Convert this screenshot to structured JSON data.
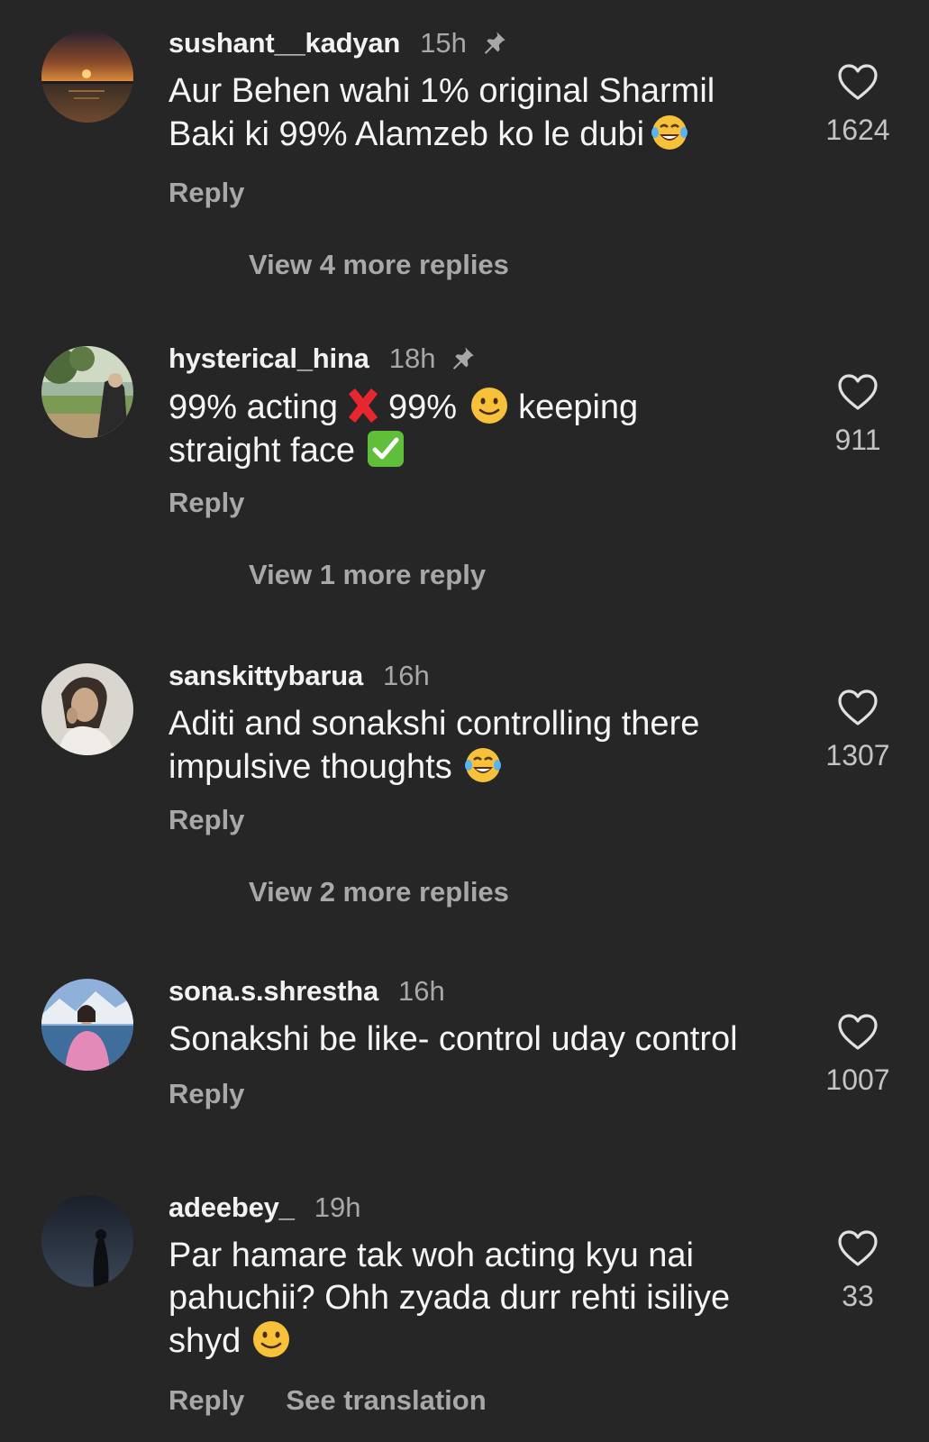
{
  "comments": [
    {
      "username": "sushant__kadyan",
      "time": "15h",
      "text_lines": [
        "Aur Behen wahi 1% original Sharmil",
        "Baki ki 99% Alamzeb ko le dubi"
      ],
      "emoji_end": "laughing-tears",
      "reply_label": "Reply",
      "view_more": "View 4 more replies",
      "likes": "1624",
      "pinned": true
    },
    {
      "username": "hysterical_hina",
      "time": "18h",
      "text_parts": [
        "99% acting",
        "99%",
        "keeping",
        "straight face"
      ],
      "reply_label": "Reply",
      "view_more": "View 1 more reply",
      "likes": "911",
      "pinned": true
    },
    {
      "username": "sanskittybarua",
      "time": "16h",
      "text_lines": [
        "Aditi and sonakshi controlling there",
        "impulsive thoughts"
      ],
      "emoji_end": "laughing-tears",
      "reply_label": "Reply",
      "view_more": "View 2 more replies",
      "likes": "1307",
      "pinned": false
    },
    {
      "username": "sona.s.shrestha",
      "time": "16h",
      "text_lines": [
        "Sonakshi be like- control uday control"
      ],
      "reply_label": "Reply",
      "likes": "1007",
      "pinned": false
    },
    {
      "username": "adeebey_",
      "time": "19h",
      "text_lines": [
        "Par hamare tak woh acting kyu nai",
        "pahuchii? Ohh zyada durr rehti isiliye",
        "shyd"
      ],
      "emoji_end": "slight-smile",
      "reply_label": "Reply",
      "translate_label": "See translation",
      "likes": "33",
      "pinned": false
    }
  ],
  "colors": {
    "background": "#262626",
    "primary_text": "#f5f5f5",
    "secondary_text": "#a8a8a8"
  }
}
